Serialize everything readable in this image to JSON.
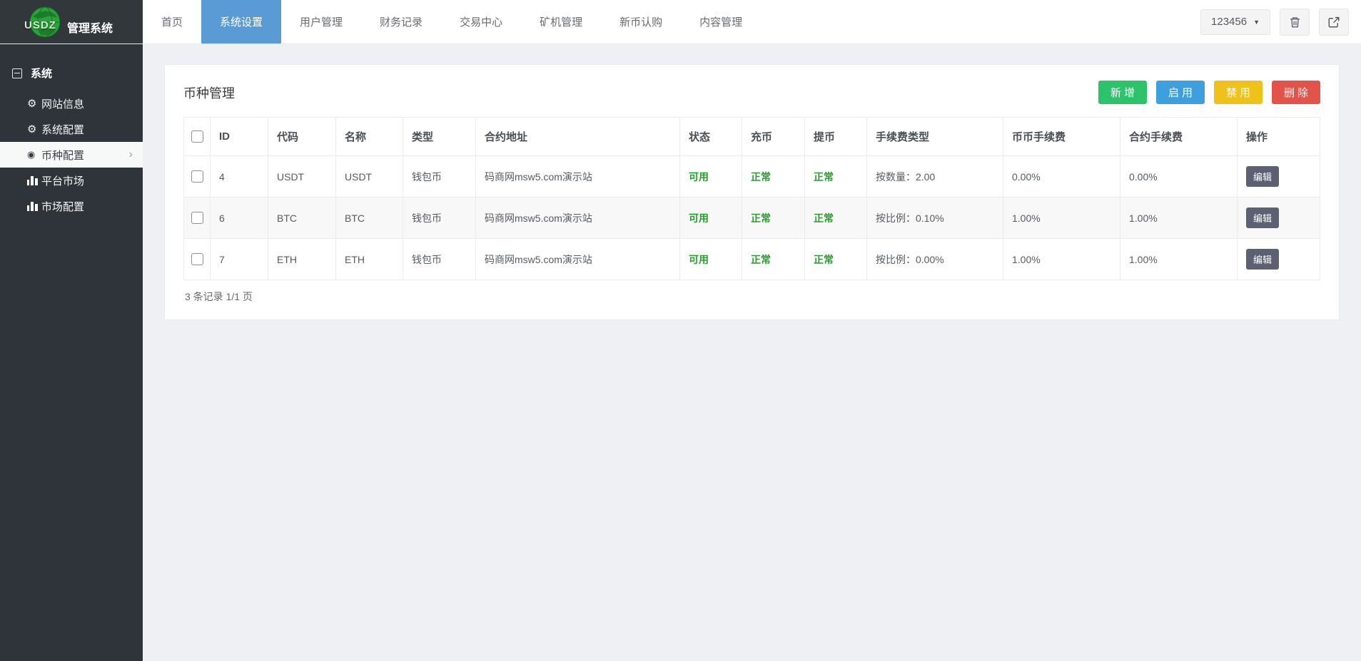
{
  "topbar": {
    "brand": "USDZ",
    "title": "管理系统",
    "nav": [
      {
        "label": "首页",
        "active": false
      },
      {
        "label": "系统设置",
        "active": true
      },
      {
        "label": "用户管理",
        "active": false
      },
      {
        "label": "财务记录",
        "active": false
      },
      {
        "label": "交易中心",
        "active": false
      },
      {
        "label": "矿机管理",
        "active": false
      },
      {
        "label": "新币认购",
        "active": false
      },
      {
        "label": "内容管理",
        "active": false
      }
    ],
    "user_dropdown": "123456",
    "caret_icon": "▼",
    "icons": {
      "trash": "trash-icon",
      "logout": "logout-icon"
    }
  },
  "sidebar": {
    "section": "系统",
    "section_icon": "minus-square-icon",
    "items": [
      {
        "label": "网站信息",
        "icon": "gear-icon",
        "active": false
      },
      {
        "label": "系统配置",
        "icon": "gear-icon",
        "active": false
      },
      {
        "label": "币种配置",
        "icon": "dot-circle-icon",
        "active": true
      },
      {
        "label": "平台市场",
        "icon": "bar-chart-icon",
        "active": false
      },
      {
        "label": "市场配置",
        "icon": "bar-chart-icon",
        "active": false
      }
    ],
    "chevron_icon": "›"
  },
  "panel": {
    "title": "币种管理",
    "actions": [
      {
        "label": "新增",
        "kind": "add",
        "color": "#2cc36b"
      },
      {
        "label": "启用",
        "kind": "enable",
        "color": "#3d9fdb"
      },
      {
        "label": "禁用",
        "kind": "disable",
        "color": "#efc21b"
      },
      {
        "label": "删除",
        "kind": "delete",
        "color": "#e25449"
      }
    ],
    "table": {
      "headers": [
        "ID",
        "代码",
        "名称",
        "类型",
        "合约地址",
        "状态",
        "充币",
        "提币",
        "手续费类型",
        "币币手续费",
        "合约手续费",
        "操作"
      ],
      "rows": [
        {
          "id": "4",
          "code": "USDT",
          "name": "USDT",
          "type": "钱包币",
          "contract": "码商网msw5.com演示站",
          "status": "可用",
          "deposit": "正常",
          "withdraw": "正常",
          "fee_type": "按数量：2.00",
          "coin_fee": "0.00%",
          "contract_fee": "0.00%",
          "action": "编辑"
        },
        {
          "id": "6",
          "code": "BTC",
          "name": "BTC",
          "type": "钱包币",
          "contract": "码商网msw5.com演示站",
          "status": "可用",
          "deposit": "正常",
          "withdraw": "正常",
          "fee_type": "按比例：0.10%",
          "coin_fee": "1.00%",
          "contract_fee": "1.00%",
          "action": "编辑"
        },
        {
          "id": "7",
          "code": "ETH",
          "name": "ETH",
          "type": "钱包币",
          "contract": "码商网msw5.com演示站",
          "status": "可用",
          "deposit": "正常",
          "withdraw": "正常",
          "fee_type": "按比例：0.00%",
          "coin_fee": "1.00%",
          "contract_fee": "1.00%",
          "action": "编辑"
        }
      ],
      "footer": "3 条记录 1/1 页"
    }
  },
  "colors": {
    "nav_active": "#5b9bd5",
    "sidebar_bg": "#2f343a",
    "topbar_dark": "#32373c",
    "status_green": "#23a12b",
    "edit_button": "#5b6173",
    "page_bg": "#eef0f4",
    "logo_globe_green": "#2aa33a"
  }
}
